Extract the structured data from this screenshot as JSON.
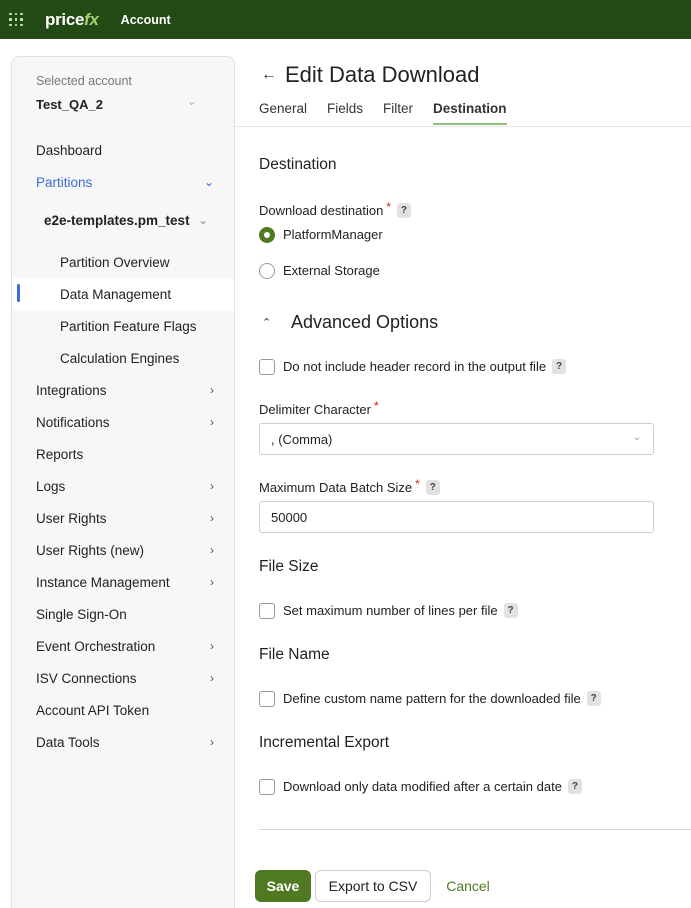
{
  "header": {
    "logo_text": "price",
    "logo_fx": "fx",
    "section": "Account"
  },
  "sidebar": {
    "selected_label": "Selected account",
    "selected_value": "Test_QA_2",
    "items": [
      {
        "label": "Dashboard"
      },
      {
        "label": "Partitions"
      },
      {
        "label": "e2e-templates.pm_test"
      },
      {
        "label": "Partition Overview"
      },
      {
        "label": "Data Management"
      },
      {
        "label": "Partition Feature Flags"
      },
      {
        "label": "Calculation Engines"
      },
      {
        "label": "Integrations"
      },
      {
        "label": "Notifications"
      },
      {
        "label": "Reports"
      },
      {
        "label": "Logs"
      },
      {
        "label": "User Rights"
      },
      {
        "label": "User Rights (new)"
      },
      {
        "label": "Instance Management"
      },
      {
        "label": "Single Sign-On"
      },
      {
        "label": "Event Orchestration"
      },
      {
        "label": "ISV Connections"
      },
      {
        "label": "Account API Token"
      },
      {
        "label": "Data Tools"
      }
    ]
  },
  "page": {
    "title": "Edit Data Download",
    "tabs": [
      {
        "label": "General"
      },
      {
        "label": "Fields"
      },
      {
        "label": "Filter"
      },
      {
        "label": "Destination"
      }
    ],
    "active_tab": "Destination"
  },
  "destination": {
    "heading": "Destination",
    "download_label": "Download destination",
    "options": [
      {
        "label": "PlatformManager",
        "selected": true
      },
      {
        "label": "External Storage",
        "selected": false
      }
    ]
  },
  "advanced": {
    "heading": "Advanced Options",
    "no_header_label": "Do not include header record in the output file",
    "delimiter_label": "Delimiter Character",
    "delimiter_value": ", (Comma)",
    "batch_label": "Maximum Data Batch Size",
    "batch_value": "50000"
  },
  "file_size": {
    "heading": "File Size",
    "checkbox_label": "Set maximum number of lines per file"
  },
  "file_name": {
    "heading": "File Name",
    "checkbox_label": "Define custom name pattern for the downloaded file"
  },
  "incremental": {
    "heading": "Incremental Export",
    "checkbox_label": "Download only data modified after a certain date"
  },
  "actions": {
    "save": "Save",
    "export": "Export to CSV",
    "cancel": "Cancel"
  },
  "help_glyph": "?",
  "colors": {
    "topbar": "#234a14",
    "accent": "#4f7a22",
    "link_blue": "#3d6bd3",
    "required": "#c4231c"
  }
}
